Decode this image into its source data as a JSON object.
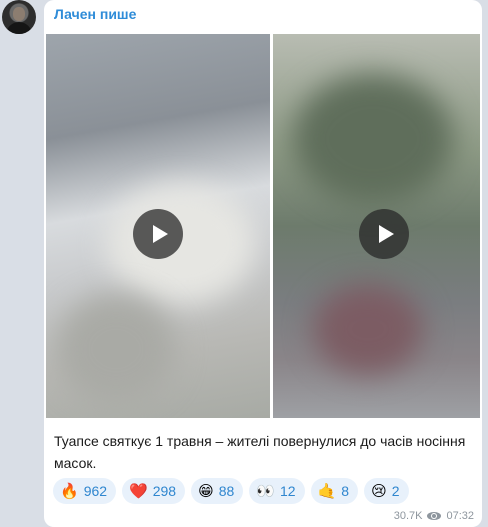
{
  "channel": {
    "sender_name": "Лачен пише"
  },
  "post": {
    "caption": "Туапсе святкує 1 травня – жителі повернулися до часів носіння масок.",
    "videos": [
      {
        "icon": "play-icon"
      },
      {
        "icon": "play-icon"
      }
    ],
    "reactions": [
      {
        "emoji": "🔥",
        "count": "962"
      },
      {
        "emoji": "❤️",
        "count": "298"
      },
      {
        "emoji": "😁",
        "count": "88"
      },
      {
        "emoji": "👀",
        "count": "12"
      },
      {
        "emoji": "🤙",
        "count": "8"
      },
      {
        "emoji": "😢",
        "count": "2"
      }
    ],
    "views": "30.7K",
    "time": "07:32"
  },
  "colors": {
    "accent": "#2f8cd8",
    "reaction_bg": "#e8f1fb",
    "chat_bg": "#d9dee6"
  }
}
